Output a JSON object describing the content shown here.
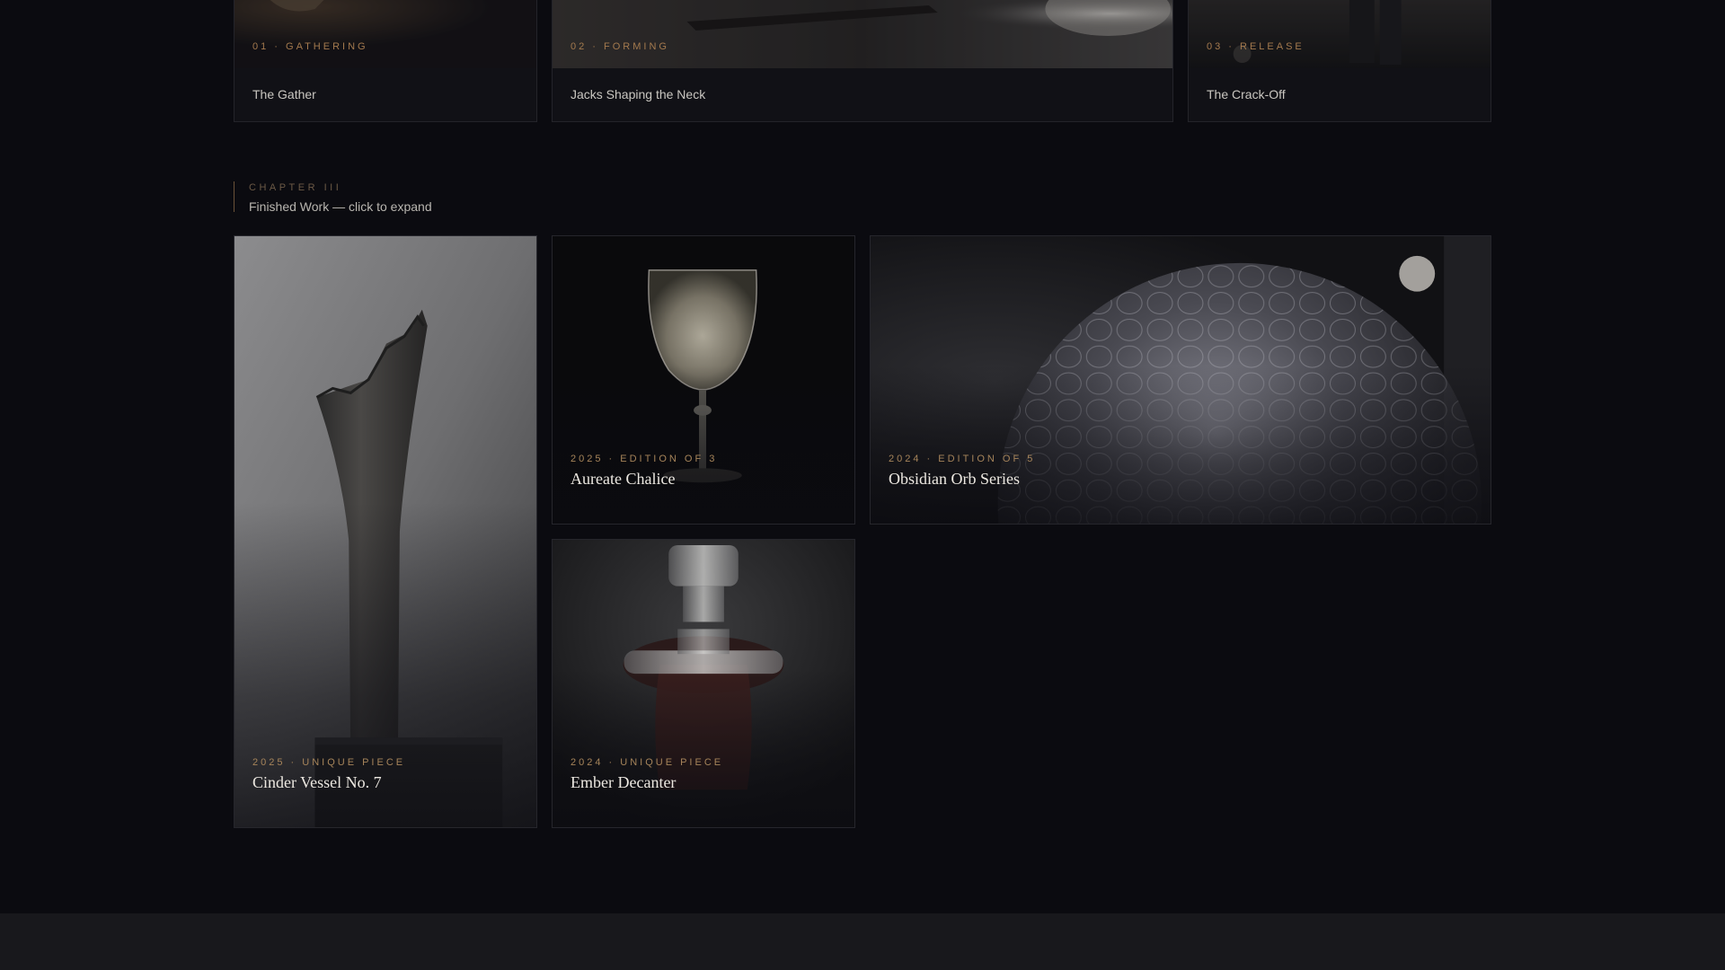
{
  "process": [
    {
      "step": "01 · GATHERING",
      "title": "The Gather"
    },
    {
      "step": "02 · FORMING",
      "title": "Jacks Shaping the Neck"
    },
    {
      "step": "03 · RELEASE",
      "title": "The Crack-Off"
    }
  ],
  "chapter": {
    "label": "CHAPTER III",
    "subtitle": "Finished Work — click to expand"
  },
  "works": {
    "cinder": {
      "meta": "2025 · UNIQUE PIECE",
      "title": "Cinder Vessel No. 7"
    },
    "chalice": {
      "meta": "2025 · EDITION OF 3",
      "title": "Aureate Chalice"
    },
    "orb": {
      "meta": "2024 · EDITION OF 5",
      "title": "Obsidian Orb Series"
    },
    "decanter": {
      "meta": "2024 · UNIQUE PIECE",
      "title": "Ember Decanter"
    }
  },
  "colors": {
    "background": "#0b0b10",
    "accent": "#a6845a",
    "card_border": "#26262c",
    "footer": "#18181c"
  }
}
